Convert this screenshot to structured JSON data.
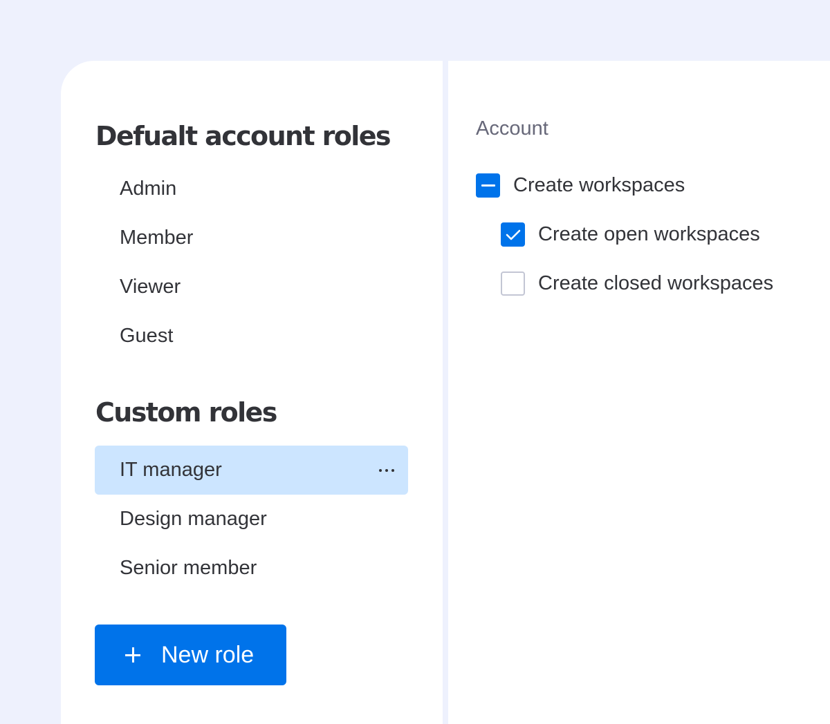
{
  "default_roles": {
    "heading": "Defualt account roles",
    "items": [
      "Admin",
      "Member",
      "Viewer",
      "Guest"
    ]
  },
  "custom_roles": {
    "heading": "Custom roles",
    "items": [
      {
        "label": "IT manager",
        "selected": true
      },
      {
        "label": "Design manager",
        "selected": false
      },
      {
        "label": "Senior member",
        "selected": false
      }
    ]
  },
  "new_role_button": {
    "label": "New role",
    "icon": "plus-icon"
  },
  "permissions": {
    "section_label": "Account",
    "items": [
      {
        "label": "Create workspaces",
        "state": "indeterminate"
      },
      {
        "label": "Create open workspaces",
        "state": "checked"
      },
      {
        "label": "Create closed workspaces",
        "state": "unchecked"
      }
    ]
  },
  "colors": {
    "page_background": "#eef1fd",
    "accent": "#0073ea",
    "selected_row": "#cce5ff",
    "text_primary": "#323338",
    "text_secondary": "#676879",
    "checkbox_border": "#c3c6d4"
  }
}
